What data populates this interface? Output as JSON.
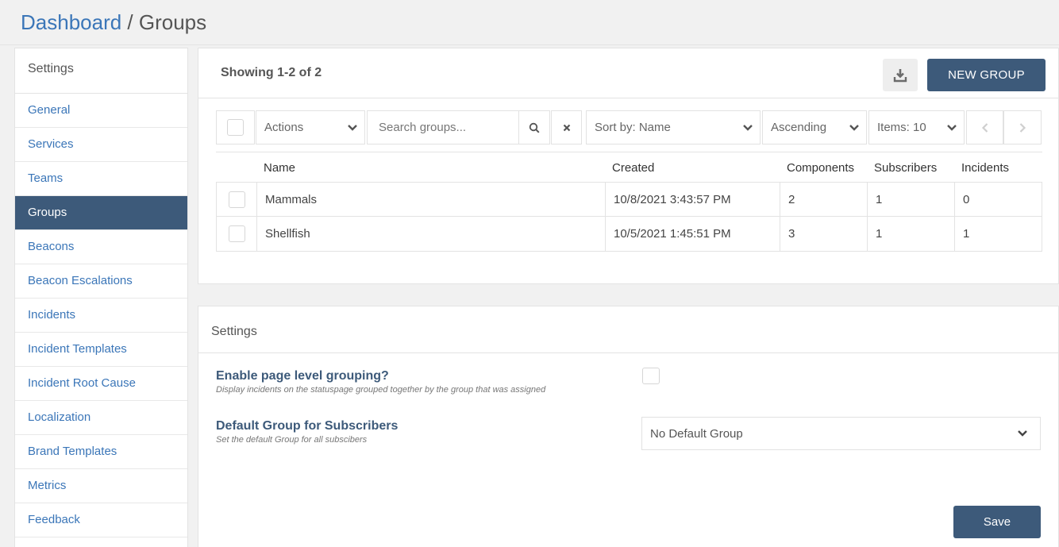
{
  "breadcrumb": {
    "parent": "Dashboard",
    "separator": " / ",
    "current": "Groups"
  },
  "sidebar": {
    "title": "Settings",
    "items": [
      {
        "label": "General"
      },
      {
        "label": "Services"
      },
      {
        "label": "Teams"
      },
      {
        "label": "Groups",
        "active": true
      },
      {
        "label": "Beacons"
      },
      {
        "label": "Beacon Escalations"
      },
      {
        "label": "Incidents"
      },
      {
        "label": "Incident Templates"
      },
      {
        "label": "Incident Root Cause"
      },
      {
        "label": "Localization"
      },
      {
        "label": "Brand Templates"
      },
      {
        "label": "Metrics"
      },
      {
        "label": "Feedback"
      }
    ]
  },
  "groups_panel": {
    "showing": "Showing 1-2 of 2",
    "new_group_label": "NEW GROUP",
    "download_icon": "download-icon",
    "toolbar": {
      "actions_label": "Actions",
      "search_placeholder": "Search groups...",
      "sort_label": "Sort by: Name",
      "order_label": "Ascending",
      "items_label": "Items: 10"
    },
    "columns": [
      "Name",
      "Created",
      "Components",
      "Subscribers",
      "Incidents"
    ],
    "rows": [
      {
        "name": "Mammals",
        "created": "10/8/2021 3:43:57 PM",
        "components": "2",
        "subscribers": "1",
        "incidents": "0"
      },
      {
        "name": "Shellfish",
        "created": "10/5/2021 1:45:51 PM",
        "components": "3",
        "subscribers": "1",
        "incidents": "1"
      }
    ]
  },
  "settings_panel": {
    "title": "Settings",
    "grouping_label": "Enable page level grouping?",
    "grouping_help": "Display incidents on the statuspage grouped together by the group that was assigned",
    "default_group_label": "Default Group for Subscribers",
    "default_group_help": "Set the default Group for all subscibers",
    "default_group_value": "No Default Group",
    "save_label": "Save"
  },
  "colors": {
    "primary": "#3d5a7a",
    "link": "#3b76b8",
    "background": "#f1f1f1"
  }
}
